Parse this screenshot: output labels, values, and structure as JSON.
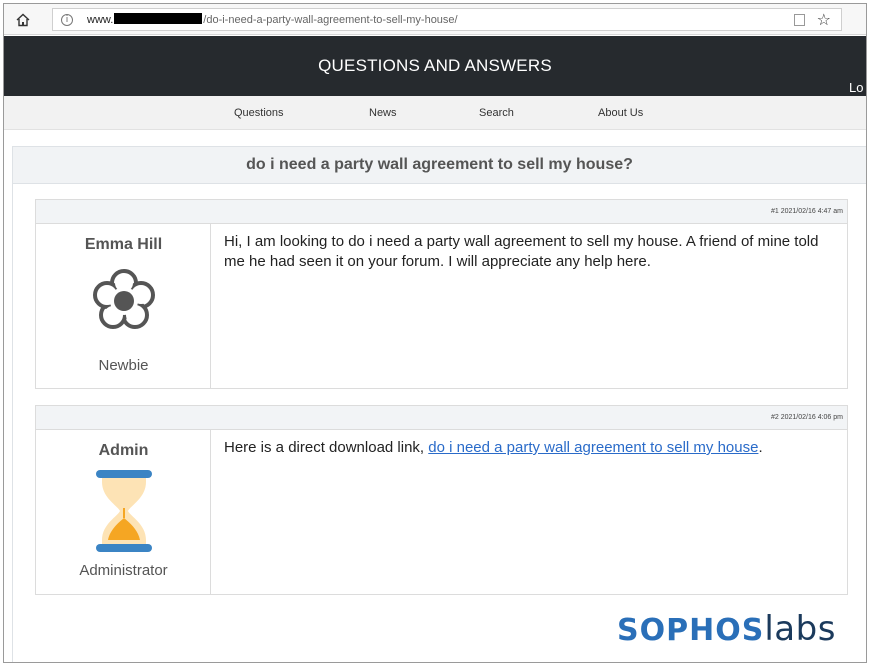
{
  "browser": {
    "url_host": "www.",
    "url_path": "/do-i-need-a-party-wall-agreement-to-sell-my-house/"
  },
  "header": {
    "site_title": "QUESTIONS AND ANSWERS",
    "login_label": "Lo"
  },
  "nav": {
    "items": [
      {
        "label": "Questions"
      },
      {
        "label": "News"
      },
      {
        "label": "Search"
      },
      {
        "label": "About Us"
      }
    ]
  },
  "page": {
    "title": "do i need a party wall agreement to sell my house?"
  },
  "posts": [
    {
      "meta": "#1 2021/02/16 4:47 am",
      "author": "Emma Hill",
      "rank": "Newbie",
      "avatar_icon": "flower-icon",
      "message": "Hi, I am looking to do i need a party wall agreement to sell my house. A friend of mine told me he had seen it on your forum. I will appreciate any help here."
    },
    {
      "meta": "#2 2021/02/16 4:06 pm",
      "author": "Admin",
      "rank": "Administrator",
      "avatar_icon": "hourglass-icon",
      "message_prefix": "Here is a direct download link, ",
      "link_text": "do i need a party wall agreement to sell my house",
      "message_suffix": "."
    }
  ],
  "watermark": {
    "part1": "SOPHOS",
    "part2": "labs"
  },
  "colors": {
    "header_bg": "#262a2e",
    "link": "#2a6bc9",
    "sophos_blue": "#2a6fb8",
    "hourglass_blue": "#3b84c4",
    "hourglass_sand": "#f5a623"
  }
}
